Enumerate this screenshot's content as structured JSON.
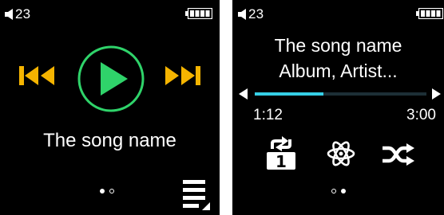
{
  "screen1": {
    "volume": "23",
    "song_title": "The song name",
    "page_indicator": {
      "current": 1,
      "total": 2
    },
    "icons": [
      "volume-icon",
      "battery-icon",
      "previous-track-icon",
      "play-icon",
      "next-track-icon",
      "playlist-icon"
    ]
  },
  "screen2": {
    "volume": "23",
    "song_title": "The song name",
    "subtitle": "Album, Artist...",
    "elapsed": "1:12",
    "duration": "3:00",
    "progress_fraction": 0.4,
    "page_indicator": {
      "current": 2,
      "total": 2
    },
    "icons": [
      "volume-icon",
      "battery-icon",
      "seek-back-icon",
      "seek-forward-icon",
      "repeat-one-icon",
      "atom-icon",
      "shuffle-icon"
    ]
  },
  "colors": {
    "background": "#000000",
    "accent_orange": "#f5b400",
    "play_green": "#2fd36a",
    "progress_cyan": "#35cfe6",
    "text": "#ffffff"
  }
}
